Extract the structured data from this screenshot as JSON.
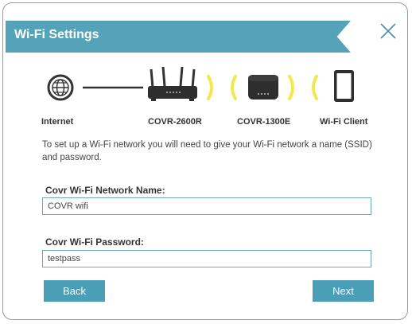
{
  "dialog": {
    "title": "Wi-Fi Settings",
    "close_icon": "close-icon"
  },
  "topology": {
    "nodes": [
      {
        "label": "Internet",
        "icon": "globe-icon"
      },
      {
        "label": "COVR-2600R",
        "icon": "router-icon"
      },
      {
        "label": "COVR-1300E",
        "icon": "extender-icon"
      },
      {
        "label": "Wi-Fi Client",
        "icon": "tablet-icon"
      }
    ],
    "wifi_signal_color": "#f2e94e"
  },
  "description": "To set up a Wi-Fi network you will need to give your Wi-Fi network a name (SSID) and password.",
  "form": {
    "network_name": {
      "label": "Covr Wi-Fi Network Name:",
      "value": "COVR wifi"
    },
    "password": {
      "label": "Covr Wi-Fi Password:",
      "value": "testpass"
    }
  },
  "buttons": {
    "back": "Back",
    "next": "Next"
  },
  "colors": {
    "accent": "#55a3b9",
    "button": "#4a9eb6"
  }
}
